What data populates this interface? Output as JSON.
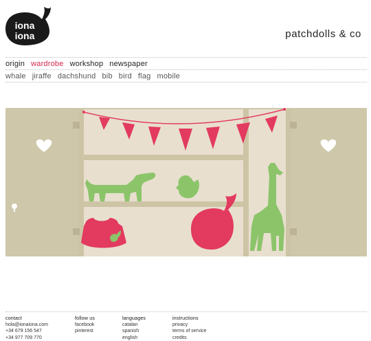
{
  "logo": {
    "line1": "iona",
    "line2": "iona",
    "colors": {
      "dark": "#1a1a1a",
      "light": "#ffffff"
    }
  },
  "brand": "patchdolls & co",
  "nav": [
    {
      "label": "origin",
      "active": false
    },
    {
      "label": "wardrobe",
      "active": true
    },
    {
      "label": "workshop",
      "active": false
    },
    {
      "label": "newspaper",
      "active": false
    }
  ],
  "subnav": [
    "whale",
    "jiraffe",
    "dachshund",
    "bib",
    "bird",
    "flag",
    "mobile"
  ],
  "illustration": {
    "colors": {
      "background": "#cec7a9",
      "cabinet": "#e8dfcf",
      "frame": "#cdc4a6",
      "accent_red": "#e33a5f",
      "accent_green": "#8cc46a",
      "heart": "#ffffff"
    },
    "icons": [
      "heart-icon",
      "keyhole-icon",
      "bunting-flags",
      "dachshund-figure",
      "bird-figure",
      "whale-figure",
      "giraffe-figure",
      "bib-figure"
    ]
  },
  "footer": {
    "contact": {
      "heading": "contact",
      "lines": [
        "hola@ionaiona.com",
        "+34 679 156 547",
        "+34 977 709 770"
      ]
    },
    "follow": {
      "heading": "follow us",
      "lines": [
        "facebook",
        "pinterest"
      ]
    },
    "languages": {
      "heading": "languages",
      "lines": [
        "catalan",
        "spanish",
        "english"
      ]
    },
    "instructions": {
      "heading": "instructions",
      "lines": [
        "privacy",
        "terms of service",
        "credits"
      ]
    }
  }
}
